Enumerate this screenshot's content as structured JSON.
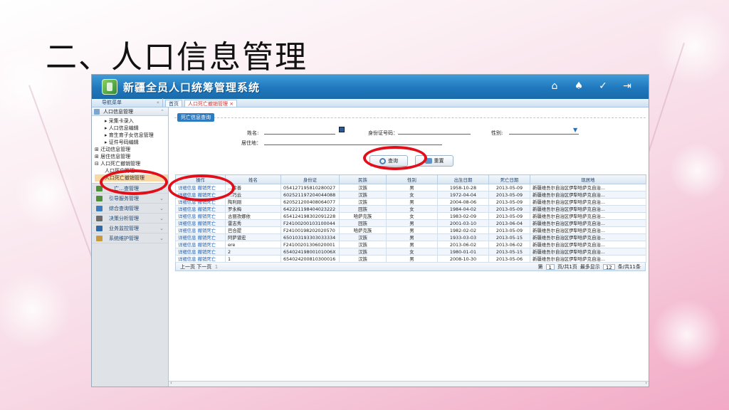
{
  "slide_title": "二、人口信息管理",
  "app": {
    "title": "新疆全员人口统筹管理系统",
    "header_icons": [
      "home-icon",
      "bell-icon",
      "tools-icon",
      "logout-icon"
    ]
  },
  "tabs": {
    "nav_label": "导航菜单",
    "items": [
      {
        "label": "首页",
        "active": false
      },
      {
        "label": "人口死亡撤销管理 ×",
        "active": true
      }
    ]
  },
  "sidebar": {
    "group_title": "人口信息管理",
    "tree": [
      {
        "label": "▸ 采集卡录入",
        "level": 2,
        "type": "leaf"
      },
      {
        "label": "▸ 人口信息编辑",
        "level": 2,
        "type": "leaf"
      },
      {
        "label": "▸ 育生育子女信息管理",
        "level": 2,
        "type": "leaf"
      },
      {
        "label": "▸ 证件号码编辑",
        "level": 2,
        "type": "leaf"
      },
      {
        "label": "⊞ 迁动信息管理",
        "level": 1,
        "type": "folder"
      },
      {
        "label": "⊞ 居住信息管理",
        "level": 1,
        "type": "folder"
      },
      {
        "label": "⊟ 人口死亡撤销管理",
        "level": 1,
        "type": "folder"
      },
      {
        "label": "人口死亡管理",
        "level": 2,
        "type": "leaf"
      },
      {
        "label": "人口死亡撤销管理",
        "level": 2,
        "type": "leaf",
        "selected": true
      }
    ],
    "menus": [
      {
        "label": "…亡…查管理",
        "color": "#4f8f3a"
      },
      {
        "label": "引导服务管理",
        "color": "#4f8f3a"
      },
      {
        "label": "综合查询管理",
        "color": "#3b7bbf"
      },
      {
        "label": "决策分析管理",
        "color": "#6b6b6b"
      },
      {
        "label": "业务监控管理",
        "color": "#2f6aa8"
      },
      {
        "label": "系统维护管理",
        "color": "#c79a3a"
      }
    ]
  },
  "search": {
    "section_title": "死亡信息查询",
    "name_label": "姓名:",
    "id_label": "身份证号码：",
    "gender_label": "性别:",
    "address_label": "居住地：",
    "name_value": "",
    "id_value": "",
    "gender_value": "",
    "address_value": "",
    "query_button": "查询",
    "reset_button": "重置"
  },
  "table": {
    "columns": [
      "操作",
      "姓名",
      "身份证",
      "民族",
      "性别",
      "出生日期",
      "死亡日期",
      "现居地"
    ],
    "action_detail": "详细信息",
    "action_revoke": "撤销死亡",
    "rows": [
      [
        "…徐善",
        "054127195810280027",
        "汉族",
        "男",
        "1958-10-28",
        "2013-05-09",
        "新疆维吾尔自治区伊犁哈萨克自治..."
      ],
      [
        "…巧云",
        "602521197204044088",
        "汉族",
        "女",
        "1972-04-04",
        "2013-05-09",
        "新疆维吾尔自治区伊犁哈萨克自治..."
      ],
      [
        "陶利刚",
        "620521200408064077",
        "汉族",
        "男",
        "2004-08-06",
        "2013-05-09",
        "新疆维吾尔自治区伊犁哈萨克自治..."
      ],
      [
        "罗永梅",
        "642221198404023222",
        "回族",
        "女",
        "1984-04-02",
        "2013-05-09",
        "新疆维吾尔自治区伊犁哈萨克自治..."
      ],
      [
        "古丽孜娜依",
        "654124198302091228",
        "哈萨克族",
        "女",
        "1983-02-09",
        "2013-05-09",
        "新疆维吾尔自治区伊犁哈萨克自治..."
      ],
      [
        "雷志秀",
        "F24100200103100044",
        "回族",
        "男",
        "2001-03-10",
        "2013-06-04",
        "新疆维吾尔自治区伊犁哈萨克自治..."
      ],
      [
        "巴合提",
        "F24100198202020570",
        "哈萨克族",
        "男",
        "1982-02-02",
        "2013-05-09",
        "新疆维吾尔自治区伊犁哈萨克自治..."
      ],
      [
        "阿萨谱宏",
        "650103193303033334",
        "汉族",
        "男",
        "1933-03-03",
        "2013-05-15",
        "新疆维吾尔自治区伊犁哈萨克自治..."
      ],
      [
        "ere",
        "F24100201306020001",
        "汉族",
        "男",
        "2013-06-02",
        "2013-06-02",
        "新疆维吾尔自治区伊犁哈萨克自治..."
      ],
      [
        "2",
        "65402419800101006X",
        "汉族",
        "女",
        "1980-01-01",
        "2013-05-15",
        "新疆维吾尔自治区伊犁哈萨克自治..."
      ],
      [
        "1",
        "654024200810300016",
        "汉族",
        "男",
        "2008-10-30",
        "2013-05-06",
        "新疆维吾尔自治区伊犁哈萨克自治..."
      ]
    ]
  },
  "pager": {
    "prev": "上一页",
    "next": "下一页",
    "current_marker": "1",
    "page_label": "第",
    "page_value": "1",
    "page_suffix": "页/共1页",
    "show_label": "最多显示",
    "show_value": "12",
    "show_suffix": "条/共11条"
  }
}
